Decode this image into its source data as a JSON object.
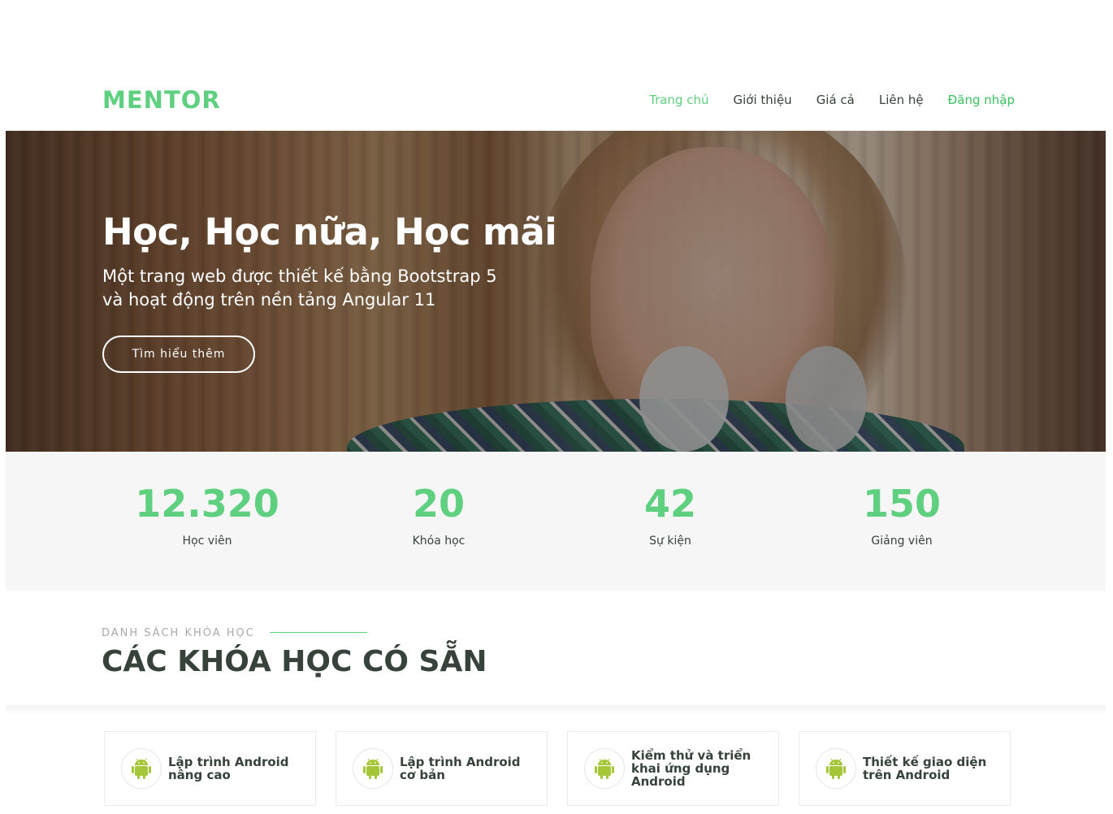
{
  "header": {
    "logo": "MENTOR",
    "nav": [
      "Trang chủ",
      "Giới thiệu",
      "Giá cả",
      "Liên hệ",
      "Đăng nhập"
    ]
  },
  "hero": {
    "title": "Học, Học nữa, Học mãi",
    "subtitle_line1": "Một trang web được thiết kế bằng Bootstrap 5",
    "subtitle_line2": "và hoạt động trên nền tảng Angular 11",
    "button": "Tìm hiểu thêm"
  },
  "counts": [
    {
      "value": "12.320",
      "label": "Học viên"
    },
    {
      "value": "20",
      "label": "Khóa học"
    },
    {
      "value": "42",
      "label": "Sự kiện"
    },
    {
      "value": "150",
      "label": "Giảng viên"
    }
  ],
  "section": {
    "subtitle": "DANH SÁCH KHÓA HỌC",
    "title": "CÁC KHÓA HỌC CÓ SẴN"
  },
  "courses": [
    {
      "icon": "android-icon",
      "title": "Lập trình Android nâng cao"
    },
    {
      "icon": "android-icon",
      "title": "Lập trình Android cơ bản"
    },
    {
      "icon": "android-icon",
      "title": "Kiểm thử và triển khai ứng dụng Android"
    },
    {
      "icon": "android-icon",
      "title": "Thiết kế giao diện trên Android"
    }
  ],
  "colors": {
    "accent": "#5fcf80",
    "text": "#37423b",
    "login": "#3ac162",
    "android": "#a4c639"
  }
}
